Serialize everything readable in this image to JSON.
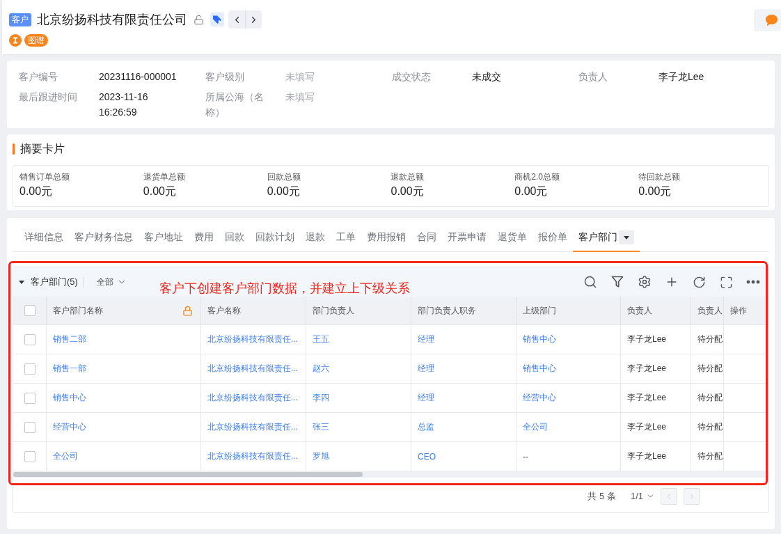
{
  "header": {
    "type_tag": "客户",
    "title": "北京纷扬科技有限责任公司",
    "graph_link": "图谱"
  },
  "info_fields": [
    {
      "label": "客户编号",
      "value": "20231116-000001",
      "empty": false
    },
    {
      "label": "客户级别",
      "value": "未填写",
      "empty": true
    },
    {
      "label": "成交状态",
      "value": "未成交",
      "empty": false
    },
    {
      "label": "负责人",
      "value": "李子龙Lee",
      "empty": false
    },
    {
      "label": "最后跟进时间",
      "value": "2023-11-16 16:26:59",
      "empty": false
    },
    {
      "label": "所属公海（名称）",
      "value": "未填写",
      "empty": true
    }
  ],
  "summary": {
    "title": "摘要卡片",
    "items": [
      {
        "label": "销售订单总额",
        "value": "0.00元"
      },
      {
        "label": "退货单总额",
        "value": "0.00元"
      },
      {
        "label": "回款总额",
        "value": "0.00元"
      },
      {
        "label": "退款总额",
        "value": "0.00元"
      },
      {
        "label": "商机2.0总额",
        "value": "0.00元"
      },
      {
        "label": "待回款总额",
        "value": "0.00元"
      }
    ]
  },
  "tabs": [
    {
      "label": "详细信息",
      "selected": false
    },
    {
      "label": "客户财务信息",
      "selected": false
    },
    {
      "label": "客户地址",
      "selected": false
    },
    {
      "label": "费用",
      "selected": false
    },
    {
      "label": "回款",
      "selected": false
    },
    {
      "label": "回款计划",
      "selected": false
    },
    {
      "label": "退款",
      "selected": false
    },
    {
      "label": "工单",
      "selected": false
    },
    {
      "label": "费用报销",
      "selected": false
    },
    {
      "label": "合同",
      "selected": false
    },
    {
      "label": "开票申请",
      "selected": false
    },
    {
      "label": "退货单",
      "selected": false
    },
    {
      "label": "报价单",
      "selected": false
    },
    {
      "label": "客户部门",
      "selected": true
    }
  ],
  "department_table": {
    "title": "客户部门(5)",
    "expanded": true,
    "filter": "全部",
    "annotation": "客户下创建客户部门数据，并建立上下级关系",
    "select_all_checked": false,
    "columns": [
      {
        "label": "客户部门名称",
        "locked": true
      },
      {
        "label": "客户名称",
        "locked": false
      },
      {
        "label": "部门负责人",
        "locked": false
      },
      {
        "label": "部门负责人职务",
        "locked": false
      },
      {
        "label": "上级部门",
        "locked": false
      },
      {
        "label": "负责人",
        "locked": false
      },
      {
        "label": "负责人",
        "locked": false
      },
      {
        "label": "操作",
        "locked": false
      }
    ],
    "rows": [
      {
        "checked": false,
        "cells": [
          {
            "text": "销售二部",
            "link": true
          },
          {
            "text": "北京纷扬科技有限责任...",
            "link": true
          },
          {
            "text": "王五",
            "link": true
          },
          {
            "text": "经理",
            "link": true
          },
          {
            "text": "销售中心",
            "link": true
          },
          {
            "text": "李子龙Lee",
            "link": false
          },
          {
            "text": "待分配",
            "link": false
          }
        ]
      },
      {
        "checked": false,
        "cells": [
          {
            "text": "销售一部",
            "link": true
          },
          {
            "text": "北京纷扬科技有限责任...",
            "link": true
          },
          {
            "text": "赵六",
            "link": true
          },
          {
            "text": "经理",
            "link": true
          },
          {
            "text": "销售中心",
            "link": true
          },
          {
            "text": "李子龙Lee",
            "link": false
          },
          {
            "text": "待分配",
            "link": false
          }
        ]
      },
      {
        "checked": false,
        "cells": [
          {
            "text": "销售中心",
            "link": true
          },
          {
            "text": "北京纷扬科技有限责任...",
            "link": true
          },
          {
            "text": "李四",
            "link": true
          },
          {
            "text": "经理",
            "link": true
          },
          {
            "text": "经营中心",
            "link": true
          },
          {
            "text": "李子龙Lee",
            "link": false
          },
          {
            "text": "待分配",
            "link": false
          }
        ]
      },
      {
        "checked": false,
        "cells": [
          {
            "text": "经营中心",
            "link": true
          },
          {
            "text": "北京纷扬科技有限责任...",
            "link": true
          },
          {
            "text": "张三",
            "link": true
          },
          {
            "text": "总监",
            "link": true
          },
          {
            "text": "全公司",
            "link": true
          },
          {
            "text": "李子龙Lee",
            "link": false
          },
          {
            "text": "待分配",
            "link": false
          }
        ]
      },
      {
        "checked": false,
        "cells": [
          {
            "text": "全公司",
            "link": true
          },
          {
            "text": "北京纷扬科技有限责任...",
            "link": true
          },
          {
            "text": "罗旭",
            "link": true
          },
          {
            "text": "CEO",
            "link": true
          },
          {
            "text": "--",
            "link": false
          },
          {
            "text": "李子龙Lee",
            "link": false
          },
          {
            "text": "待分配",
            "link": false
          }
        ]
      }
    ],
    "pagination": {
      "total": "共 5 条",
      "page": "1/1",
      "prev_disabled": true,
      "next_disabled": true
    }
  }
}
